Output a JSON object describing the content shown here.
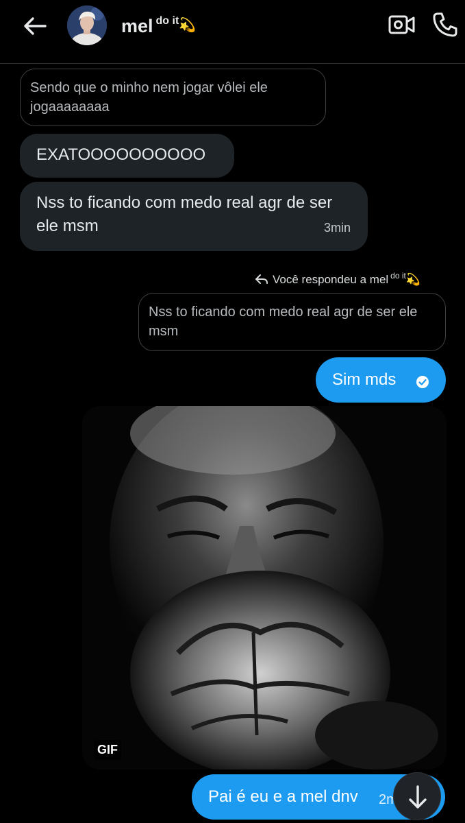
{
  "header": {
    "contact_name": "mel",
    "contact_suffix": "do it",
    "contact_emoji": "💫",
    "back_icon": "arrow-left-icon",
    "video_icon": "video-call-icon",
    "call_icon": "phone-icon"
  },
  "messages": {
    "m1": "Sendo que o minho nem jogar vôlei ele jogaaaaaaaa",
    "m2": "EXATOOOOOOOOOO",
    "m3": "Nss to ficando com medo real agr de ser ele msm",
    "m3_time": "3min",
    "reply_note": "Você respondeu a mel",
    "reply_suffix": "do it",
    "reply_emoji": "💫",
    "quoted": "Nss to ficando com medo real agr de ser ele msm",
    "m4": "Sim mds",
    "gif_badge": "GIF",
    "m5": "Pai é eu e a mel dnv",
    "m5_time": "2m"
  },
  "colors": {
    "background": "#000000",
    "incoming_bubble": "#1d2327",
    "outgoing_bubble": "#1d9bf0",
    "text": "#e7e9ea"
  }
}
